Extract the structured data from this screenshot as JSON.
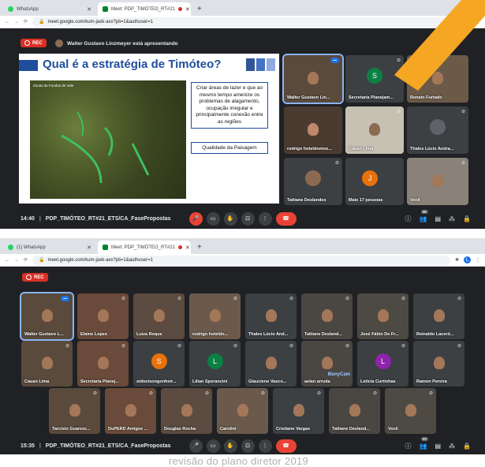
{
  "shot1": {
    "tabs": [
      {
        "label": "WhatsApp",
        "active": false
      },
      {
        "label": "Meet: PDP_TIMÓTEO_RT#21",
        "active": true
      }
    ],
    "url": "meet.google.com/kum-jaxk-axx?pli=1&authuser=1",
    "rec_label": "REC",
    "presenting_text": "Walter Gustavo Linzmeyer está apresentando",
    "slide": {
      "title": "Qual é a estratégia de Timóteo?",
      "map_label": "Zonas de Fundos de Vale",
      "box1": "Criar áreas de lazer e que ao mesmo tempo amenize os problemas de alagamento, ocupação irregular e principalmente conexão entre as regiões",
      "box2": "Qualidade da Paisagem"
    },
    "participants": [
      {
        "name": "Walter Gustavo Lin...",
        "speaker": true
      },
      {
        "name": "Secretaria Planejam...",
        "initial": "S",
        "color": "#0b8043"
      },
      {
        "name": "Renato Furtado"
      },
      {
        "name": "rodrigo hoteldomno..."
      },
      {
        "name": "Cauan Lima"
      },
      {
        "name": "Thales Lúcio Andra..."
      },
      {
        "name": "Tatiiane Deslandes"
      },
      {
        "name": "Mais 17 pessoas",
        "initial": "J",
        "color": "#e8710a"
      },
      {
        "name": "Você"
      }
    ],
    "time": "14:40",
    "meeting": "PDP_TIMÓTEO_RT#21_ETS/CA_FasePropostas",
    "people_count": "26"
  },
  "shot2": {
    "tabs": [
      {
        "label": "(1) WhatsApp",
        "active": false
      },
      {
        "label": "Meet: PDP_TIMÓTEO_RT#21",
        "active": true
      }
    ],
    "url": "meet.google.com/kum-jaxk-axx?pli=1&authuser=1",
    "rec_label": "REC",
    "participants": [
      {
        "name": "Walter Gustavo L...",
        "speaker": true
      },
      {
        "name": "Elaine Lopes"
      },
      {
        "name": "Luiza Roque"
      },
      {
        "name": "rodrigo hoteldo..."
      },
      {
        "name": "Thales Lúcio And..."
      },
      {
        "name": "Tatiiane Desland..."
      },
      {
        "name": "José Fábio De Fr..."
      },
      {
        "name": "Reinaldo Lacerd..."
      },
      {
        "name": "Cauan Lima"
      },
      {
        "name": "Secretaria Planej..."
      },
      {
        "name": "sidnoisongonheir...",
        "initial": "S",
        "color": "#e8710a"
      },
      {
        "name": "Lilian Sporancini",
        "initial": "L",
        "color": "#0b8043"
      },
      {
        "name": "Glauciene Vasco..."
      },
      {
        "name": "aelan arruda"
      },
      {
        "name": "Leticia Curtinhas",
        "initial": "L",
        "color": "#8e24aa"
      },
      {
        "name": "Ramon Pereira"
      },
      {
        "name": "Tarcísio Guaresc..."
      },
      {
        "name": "DuPERD Amigos ..."
      },
      {
        "name": "Douglas Rocha"
      },
      {
        "name": "Carolini"
      },
      {
        "name": "Cristiane Vargas"
      },
      {
        "name": "Tatiiane Desland..."
      },
      {
        "name": "Você"
      }
    ],
    "tile_badge": "ManyCam",
    "time": "15:35",
    "meeting": "PDP_TIMÓTEO_RT#21_ETS/CA_FasePropostas",
    "people_count": "23"
  },
  "footer_text": "revisão do plano diretor 2019",
  "icons": [
    "whatsapp-icon",
    "meet-icon",
    "back-icon",
    "forward-icon",
    "reload-icon",
    "lock-icon",
    "mic-off-icon",
    "camera-off-icon",
    "raise-hand-icon",
    "present-icon",
    "more-icon",
    "end-call-icon",
    "info-icon",
    "people-icon",
    "chat-icon",
    "activities-icon",
    "host-controls-icon"
  ],
  "colors": {
    "meet_bg": "#202124",
    "rec": "#d93025",
    "end_call": "#ea4335",
    "slide_title": "#1f4e9c",
    "orange_arrow": "#f5a623"
  }
}
